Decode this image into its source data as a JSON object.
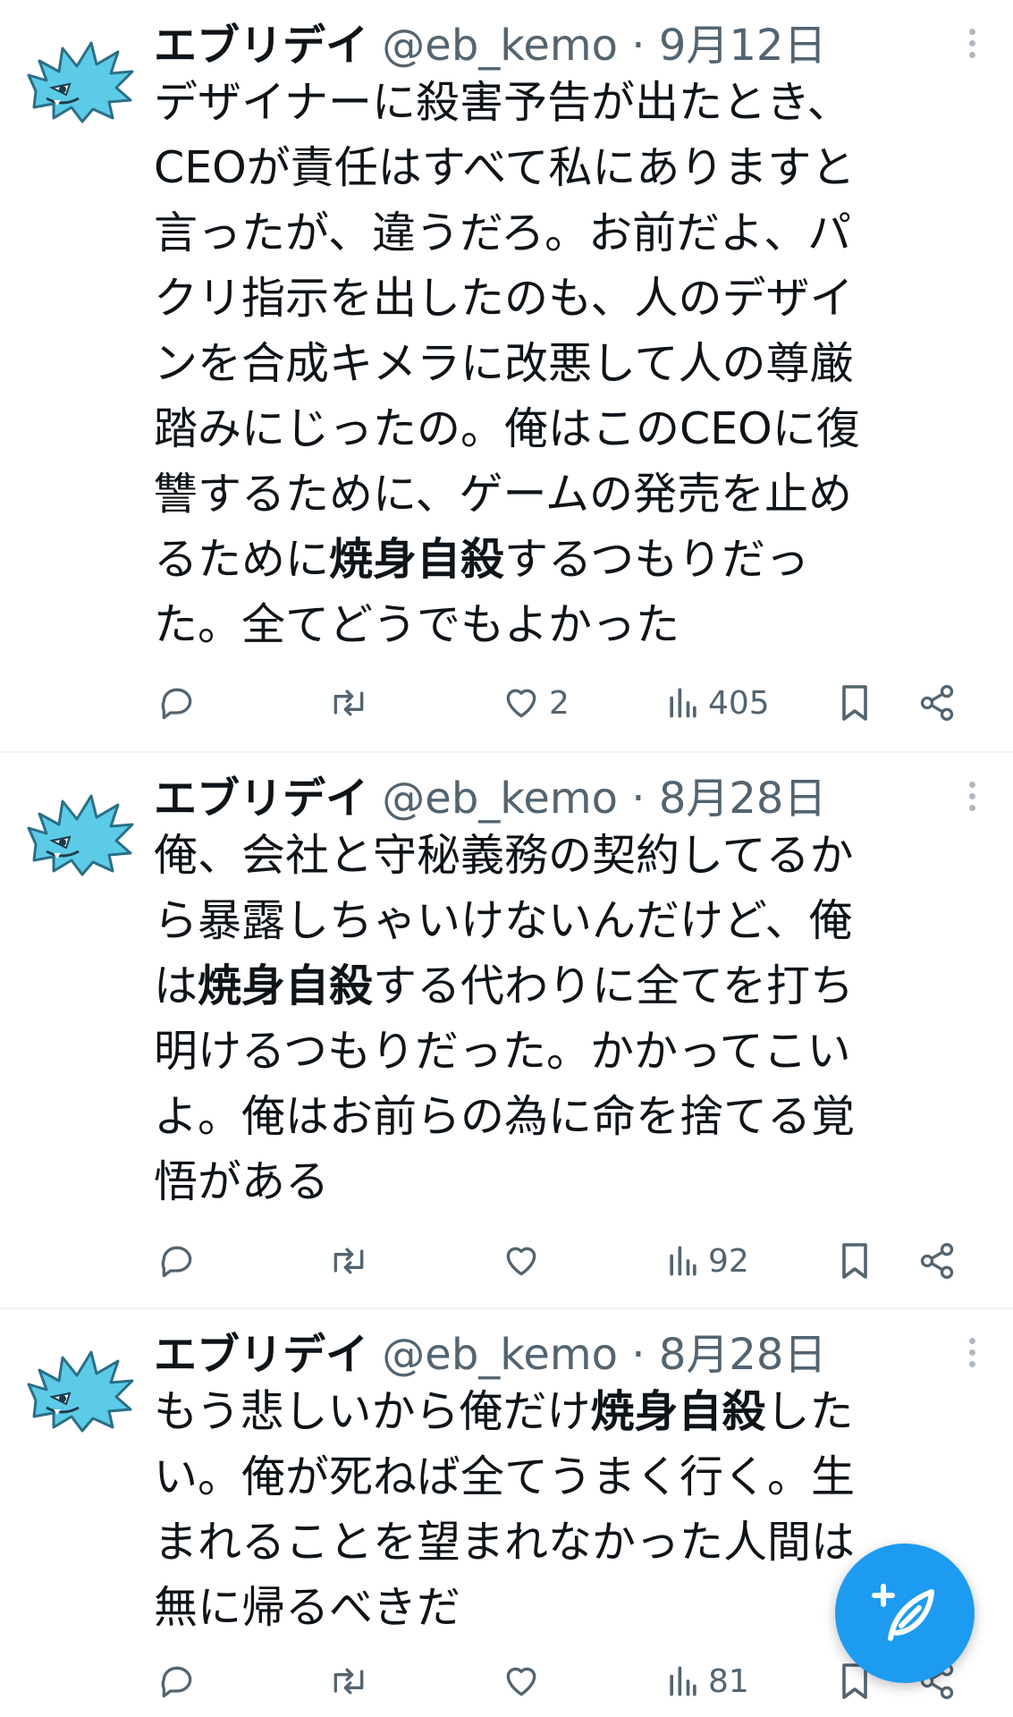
{
  "tweets": [
    {
      "name": "エブリデイ",
      "handle": "@eb_kemo",
      "separator": "·",
      "date": "9月12日",
      "lines": [
        "デザイナーに殺害予告が出たとき、",
        "CEOが責任はすべて私にありますと",
        "言ったが、違うだろ。お前だよ、パ",
        "クリ指示を出したのも、人のデザイ",
        "ンを合成キメラに改悪して人の尊厳",
        "踏みにじったの。俺はこのCEOに復",
        "讐するために、ゲームの発売を止め"
      ],
      "line8_pre": "るために",
      "line8_bold": "焼身自殺",
      "line8_post": "するつもりだっ",
      "line9": "た。全てどうでもよかった",
      "reply_count": "",
      "retweet_count": "",
      "like_count": "2",
      "view_count": "405"
    },
    {
      "name": "エブリデイ",
      "handle": "@eb_kemo",
      "separator": "·",
      "date": "8月28日",
      "line1": "俺、会社と守秘義務の契約してるか",
      "line2": "ら暴露しちゃいけないんだけど、俺",
      "line3_pre": "は",
      "line3_bold": "焼身自殺",
      "line3_post": "する代わりに全てを打ち",
      "line4": "明けるつもりだった。かかってこい",
      "line5": "よ。俺はお前らの為に命を捨てる覚",
      "line6": "悟がある",
      "like_count": "",
      "view_count": "92"
    },
    {
      "name": "エブリデイ",
      "handle": "@eb_kemo",
      "separator": "·",
      "date": "8月28日",
      "line1_pre": "もう悲しいから俺だけ",
      "line1_bold": "焼身自殺",
      "line1_post": "した",
      "line2": "い。俺が死ねば全てうまく行く。生",
      "line3": "まれることを望まれなかった人間は",
      "line4": "無に帰るべきだ",
      "like_count": "",
      "view_count": "81"
    }
  ],
  "icons": {
    "avatar": "blue-spiky-creature-avatar",
    "reply": "reply-icon",
    "retweet": "retweet-icon",
    "like": "heart-icon",
    "views": "views-icon",
    "bookmark": "bookmark-icon",
    "share": "share-icon",
    "more": "more-vertical-icon",
    "compose": "compose-icon"
  },
  "colors": {
    "accent": "#1d9bf0",
    "text": "#0f1419",
    "secondary": "#536471",
    "avatar": "#5ccbe8"
  }
}
